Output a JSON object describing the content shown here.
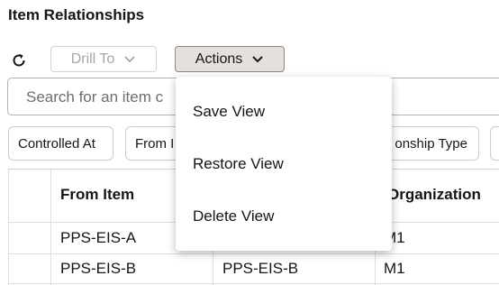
{
  "page": {
    "title": "Item Relationships"
  },
  "toolbar": {
    "refresh_icon": "refresh-icon",
    "drill_to_label": "Drill To",
    "actions_label": "Actions"
  },
  "search": {
    "placeholder": "Search for an item c"
  },
  "filters": [
    {
      "label": "Controlled At"
    },
    {
      "label": "From I"
    },
    {
      "label": "onship Type"
    }
  ],
  "table": {
    "headers": [
      "From Item",
      "",
      "Organization"
    ],
    "header_partial": {
      "org": "Organization"
    },
    "rows": [
      {
        "from_item": "PPS-EIS-A",
        "to_item": "",
        "organization": "M1"
      },
      {
        "from_item": "PPS-EIS-B",
        "to_item": "PPS-EIS-B",
        "organization": "M1"
      }
    ]
  },
  "actions_menu": {
    "items": [
      {
        "label": "Save View"
      },
      {
        "label": "Restore View"
      },
      {
        "label": "Delete View"
      }
    ]
  },
  "colors": {
    "accent_button_bg": "#e4e1dd",
    "text": "#161513",
    "disabled_text": "#a9a6a2"
  }
}
